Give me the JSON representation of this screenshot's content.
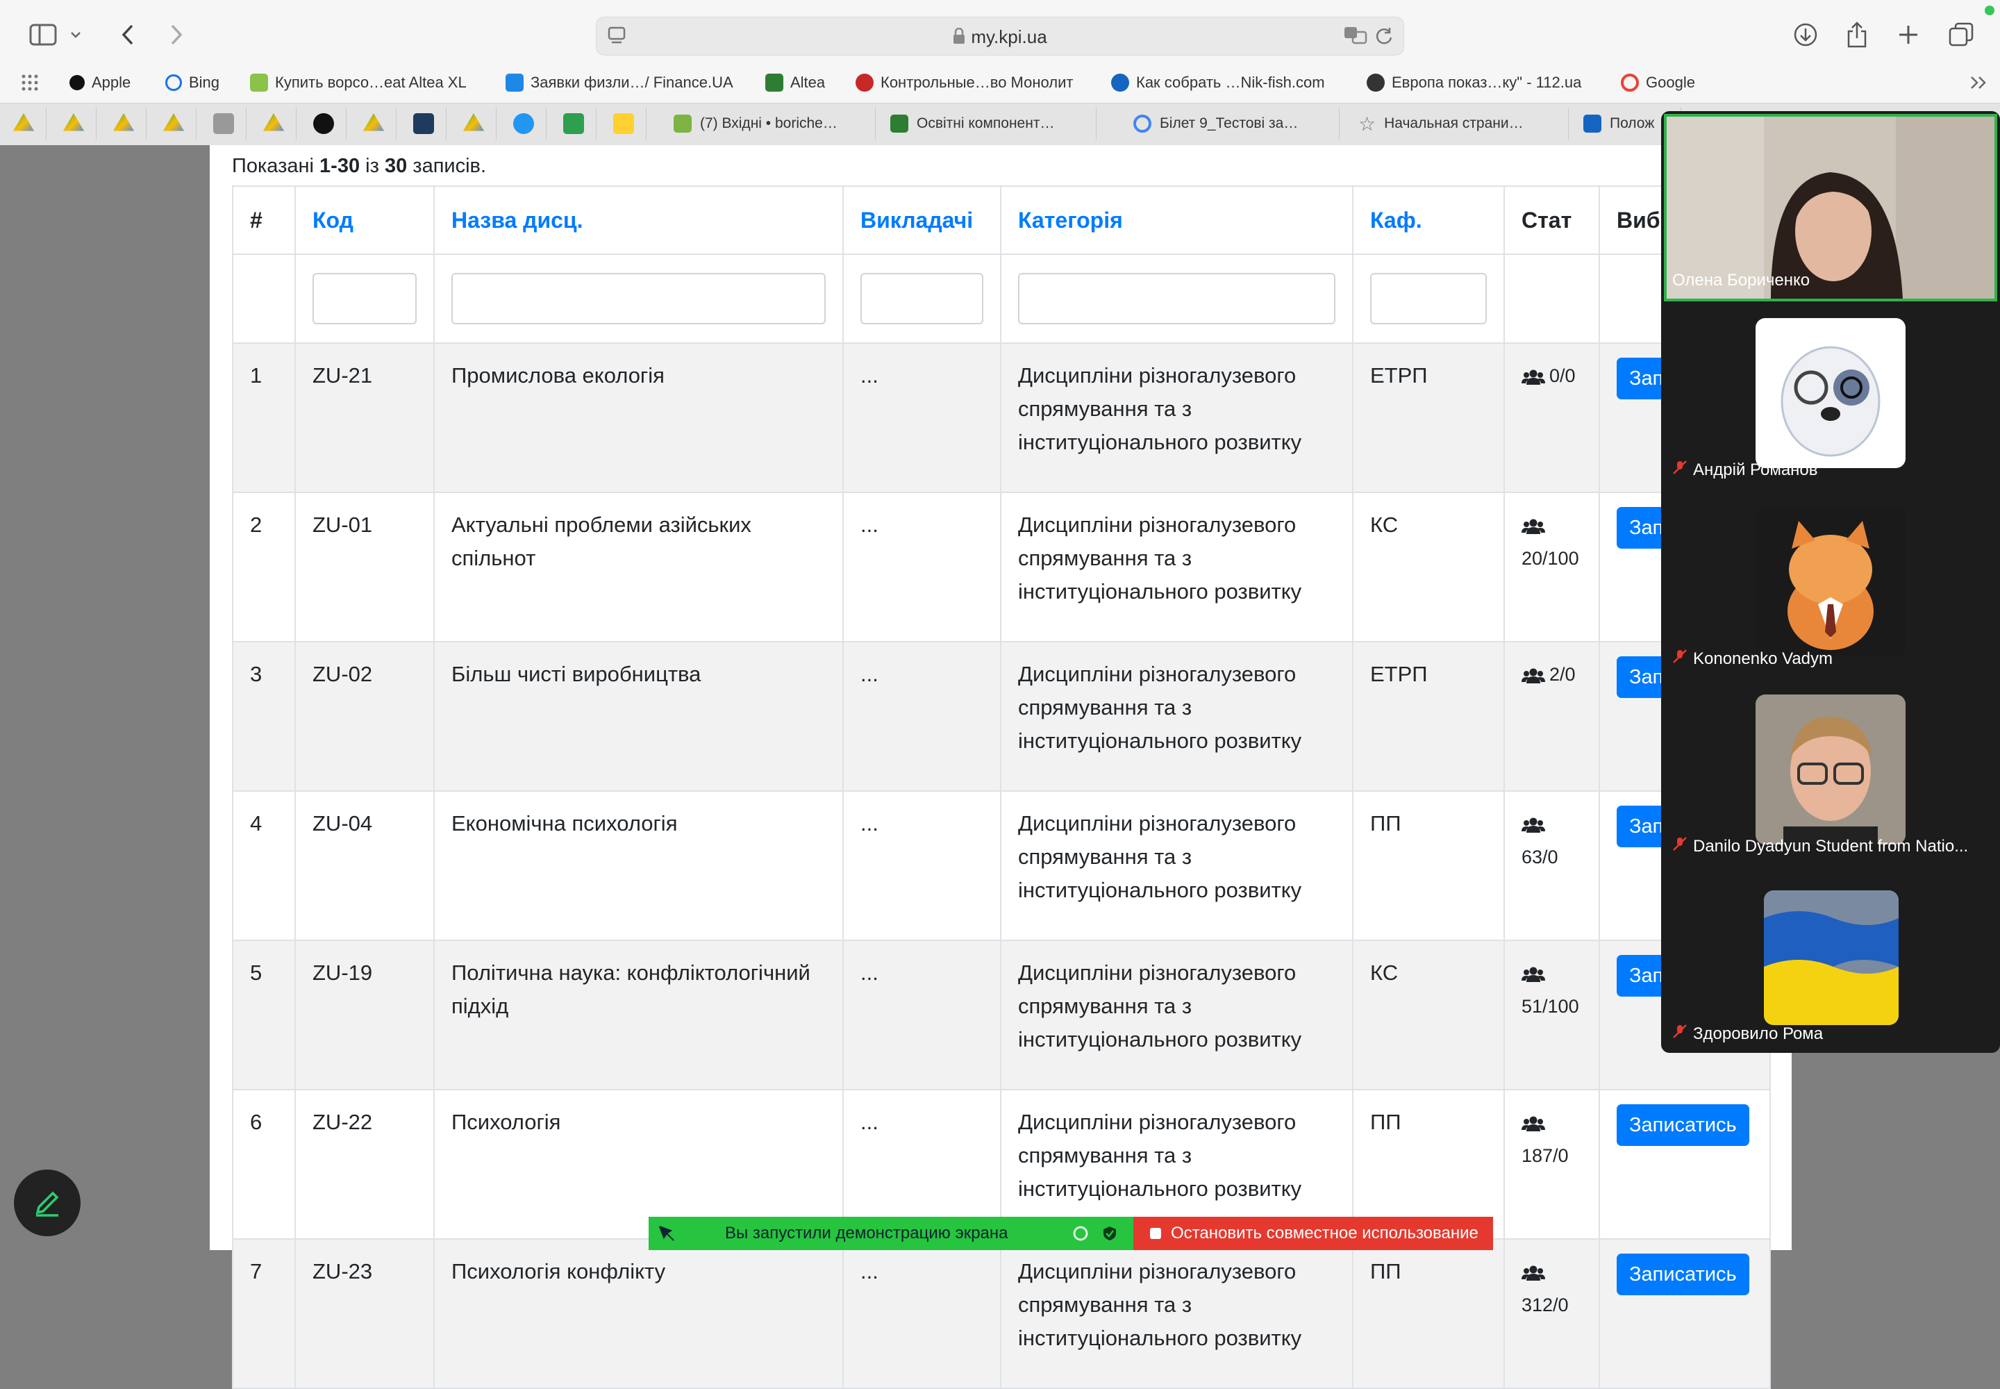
{
  "browser": {
    "url": "my.kpi.ua",
    "favorites": [
      {
        "label": "Apple",
        "color": "#111"
      },
      {
        "label": "Bing",
        "color": "#1a73e8"
      },
      {
        "label": "Купить ворсо…eat Altea XL",
        "color": "#8bc34a"
      },
      {
        "label": "Заявки физли…/ Finance.UA",
        "color": "#1e88e5"
      },
      {
        "label": "Altea",
        "color": "#2e7d32"
      },
      {
        "label": "Контрольные…во Монолит",
        "color": "#c62828"
      },
      {
        "label": "Как собрать …Nik-fish.com",
        "color": "#1565c0"
      },
      {
        "label": "Европа показ…ку\" - 112.ua",
        "color": "#333"
      },
      {
        "label": "Google",
        "color": "#ea4335"
      }
    ],
    "text_tabs": [
      {
        "label": "(7) Вхідні • boriche…",
        "color": "#7cb342"
      },
      {
        "label": "Освітні компонент…",
        "color": "#2e7d32"
      },
      {
        "label": "Білет 9_Тестові за…",
        "color": "#4285f4"
      },
      {
        "label": "Начальная страни…",
        "color": "#888"
      },
      {
        "label": "Полож",
        "color": "#1565c0"
      }
    ]
  },
  "summary": {
    "prefix": "Показані ",
    "range": "1-30",
    "mid": " із ",
    "total": "30",
    "suffix": " записів."
  },
  "table": {
    "headers": {
      "num": "#",
      "code": "Код",
      "name": "Назва дисц.",
      "teachers": "Викладачі",
      "category": "Категорія",
      "dept": "Каф.",
      "stat": "Стат",
      "choice": "Вибір"
    },
    "rows": [
      {
        "num": "1",
        "code": "ZU-21",
        "name": "Промислова екологія",
        "teachers": "...",
        "category": "Дисципліни різногалузевого спрямування та з інституціонального розвитку",
        "dept": "ЕТРП",
        "stat": "0/0",
        "button": "Записатись"
      },
      {
        "num": "2",
        "code": "ZU-01",
        "name": "Актуальні проблеми азійських спільнот",
        "teachers": "...",
        "category": "Дисципліни різногалузевого спрямування та з інституціонального розвитку",
        "dept": "КС",
        "stat": "20/100",
        "button": "Записатись"
      },
      {
        "num": "3",
        "code": "ZU-02",
        "name": "Більш чисті виробництва",
        "teachers": "...",
        "category": "Дисципліни різногалузевого спрямування та з інституціонального розвитку",
        "dept": "ЕТРП",
        "stat": "2/0",
        "button": "Записатись"
      },
      {
        "num": "4",
        "code": "ZU-04",
        "name": "Економічна психологія",
        "teachers": "...",
        "category": "Дисципліни різногалузевого спрямування та з інституціонального розвитку",
        "dept": "ПП",
        "stat": "63/0",
        "button": "Записатись"
      },
      {
        "num": "5",
        "code": "ZU-19",
        "name": "Політична наука: конфліктологічний підхід",
        "teachers": "...",
        "category": "Дисципліни різногалузевого спрямування та з інституціонального розвитку",
        "dept": "КС",
        "stat": "51/100",
        "button": "Записатись"
      },
      {
        "num": "6",
        "code": "ZU-22",
        "name": "Психологія",
        "teachers": "...",
        "category": "Дисципліни різногалузевого спрямування та з інституціонального розвитку",
        "dept": "ПП",
        "stat": "187/0",
        "button": "Записатись"
      },
      {
        "num": "7",
        "code": "ZU-23",
        "name": "Психологія конфлікту",
        "teachers": "...",
        "category": "Дисципліни різногалузевого спрямування та з інституціонального розвитку",
        "dept": "ПП",
        "stat": "312/0",
        "button": "Записатись"
      }
    ]
  },
  "call": {
    "participants": [
      {
        "name": "Олена Бориченко",
        "speaking": true
      },
      {
        "name": "Андрій Романов"
      },
      {
        "name": "Kononenko Vadym"
      },
      {
        "name": "Danilo Dyadyun Student from Natio..."
      },
      {
        "name": "Здоровило Рома"
      }
    ],
    "share_status": "Вы запустили демонстрацию экрана",
    "stop_label": "Остановить совместное использование"
  }
}
